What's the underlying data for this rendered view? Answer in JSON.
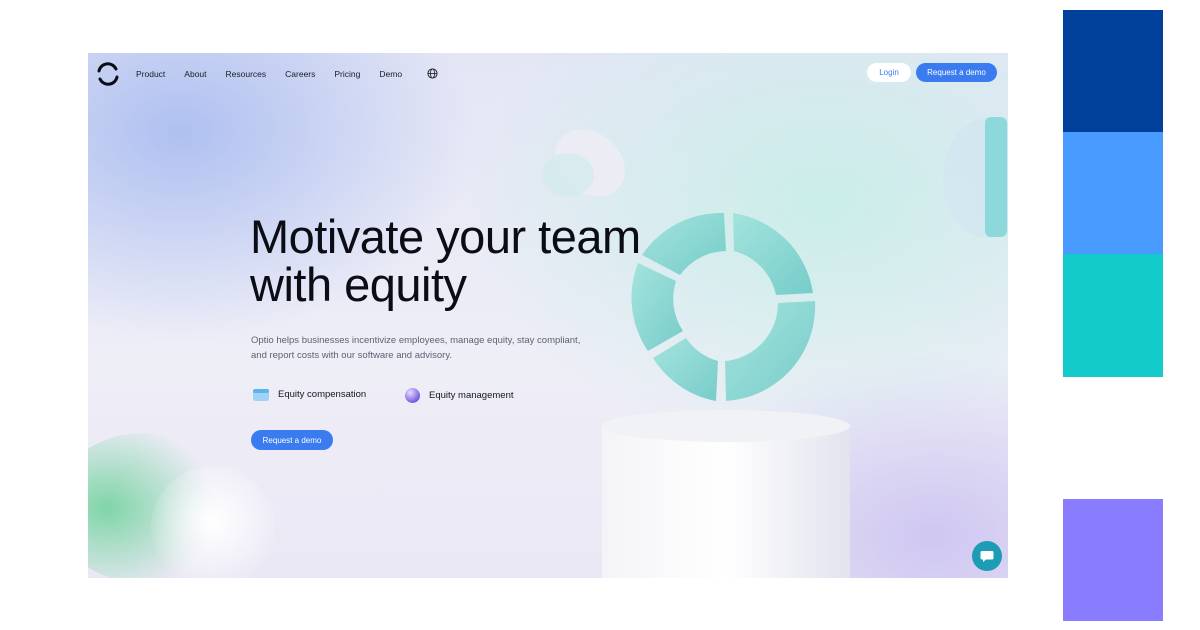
{
  "nav": {
    "items": [
      "Product",
      "About",
      "Resources",
      "Careers",
      "Pricing",
      "Demo"
    ],
    "login_label": "Login",
    "demo_label": "Request a demo"
  },
  "hero": {
    "headline_line1": "Motivate your team",
    "headline_line2": "with equity",
    "subtext": "Optio helps businesses incentivize employees, manage equity, stay compliant, and report costs with our software and advisory.",
    "features": [
      {
        "label": "Equity compensation",
        "icon": "card-icon"
      },
      {
        "label": "Equity management",
        "icon": "sphere-icon"
      }
    ],
    "cta_label": "Request a demo"
  },
  "icons": {
    "logo": "logo-icon",
    "language": "globe-icon",
    "chat": "chat-icon"
  },
  "colors": {
    "accent": "#3a7bf0",
    "chat": "#1c9cb5",
    "palette": [
      "#003f9a",
      "#4a9bff",
      "#13cbc9",
      "#8a7cff"
    ]
  }
}
